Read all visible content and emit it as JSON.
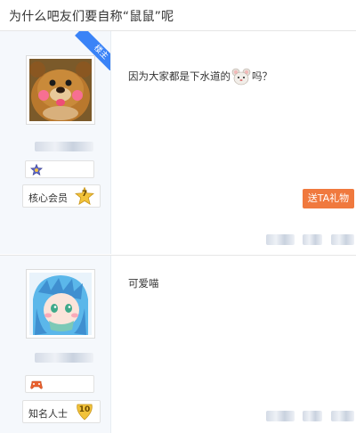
{
  "thread": {
    "title": "为什么吧友们要自称“鼠鼠”呢"
  },
  "posts": [
    {
      "corner_badge": "楼主",
      "level_name": "核心会员",
      "level": "7",
      "content_before": "因为大家都是下水道的",
      "content_after": "吗？",
      "gift_button": "送TA礼物",
      "avatar_icon": "bear-avatar-icon",
      "badge_icon": "star-badge-icon"
    },
    {
      "level_name": "知名人士",
      "level": "10",
      "content": "可爱喵",
      "avatar_icon": "anime-avatar-icon",
      "badge_icon": "gamepad-badge-icon"
    }
  ],
  "colors": {
    "accent": "#3a83f7",
    "gift": "#f0793e",
    "sidebar": "#f5f8fc"
  }
}
